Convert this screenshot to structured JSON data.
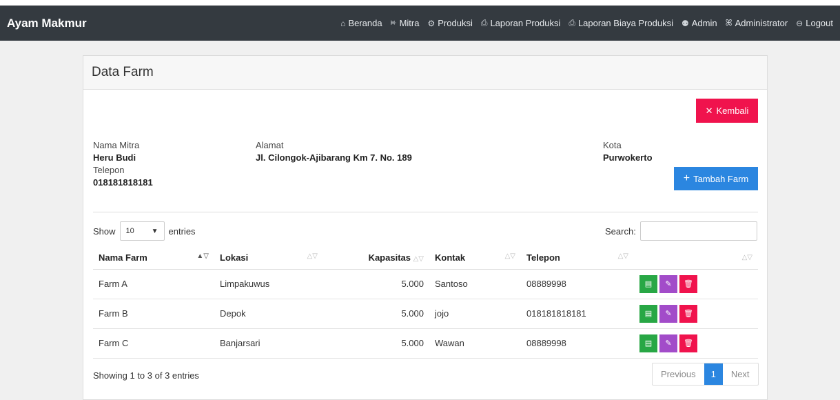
{
  "app": {
    "brand": "Ayam Makmur"
  },
  "nav": [
    {
      "label": "Beranda",
      "icon": "home-icon",
      "glyph": "⌂"
    },
    {
      "label": "Mitra",
      "icon": "users-icon",
      "glyph": "ꔜ"
    },
    {
      "label": "Produksi",
      "icon": "gear-icon",
      "glyph": "⚙"
    },
    {
      "label": "Laporan Produksi",
      "icon": "print-icon",
      "glyph": "⎙"
    },
    {
      "label": "Laporan Biaya Produksi",
      "icon": "print-icon",
      "glyph": "⎙"
    },
    {
      "label": "Admin",
      "icon": "admin-icon",
      "glyph": "⚉"
    },
    {
      "label": "Administrator",
      "icon": "user-icon",
      "glyph": "ꕤ"
    },
    {
      "label": "Logout",
      "icon": "logout-icon",
      "glyph": "⊖"
    }
  ],
  "card": {
    "title": "Data Farm"
  },
  "buttons": {
    "kembali": "Kembali",
    "kembali_glyph": "✕",
    "tambah": "Tambah Farm",
    "tambah_glyph": "+"
  },
  "mitra": {
    "nama_label": "Nama Mitra",
    "nama": "Heru Budi",
    "alamat_label": "Alamat",
    "alamat": "Jl. Cilongok-Ajibarang Km 7. No. 189",
    "kota_label": "Kota",
    "kota": "Purwokerto",
    "telepon_label": "Telepon",
    "telepon": "018181818181"
  },
  "table_controls": {
    "show_label": "Show",
    "entries_label": "entries",
    "page_size": "10",
    "search_label": "Search:"
  },
  "columns": [
    "Nama Farm",
    "Lokasi",
    "Kapasitas",
    "Kontak",
    "Telepon",
    ""
  ],
  "rows": [
    {
      "nama": "Farm A",
      "lokasi": "Limpakuwus",
      "kapasitas": "5.000",
      "kontak": "Santoso",
      "telepon": "08889998"
    },
    {
      "nama": "Farm B",
      "lokasi": "Depok",
      "kapasitas": "5.000",
      "kontak": "jojo",
      "telepon": "018181818181"
    },
    {
      "nama": "Farm C",
      "lokasi": "Banjarsari",
      "kapasitas": "5.000",
      "kontak": "Wawan",
      "telepon": "08889998"
    }
  ],
  "footer": {
    "showing": "Showing 1 to 3 of 3 entries",
    "previous": "Previous",
    "page": "1",
    "next": "Next"
  },
  "colors": {
    "navbar": "#343a40",
    "red": "#f0134d",
    "blue": "#2b86e0",
    "green": "#28a745",
    "purple": "#a24cc9"
  }
}
